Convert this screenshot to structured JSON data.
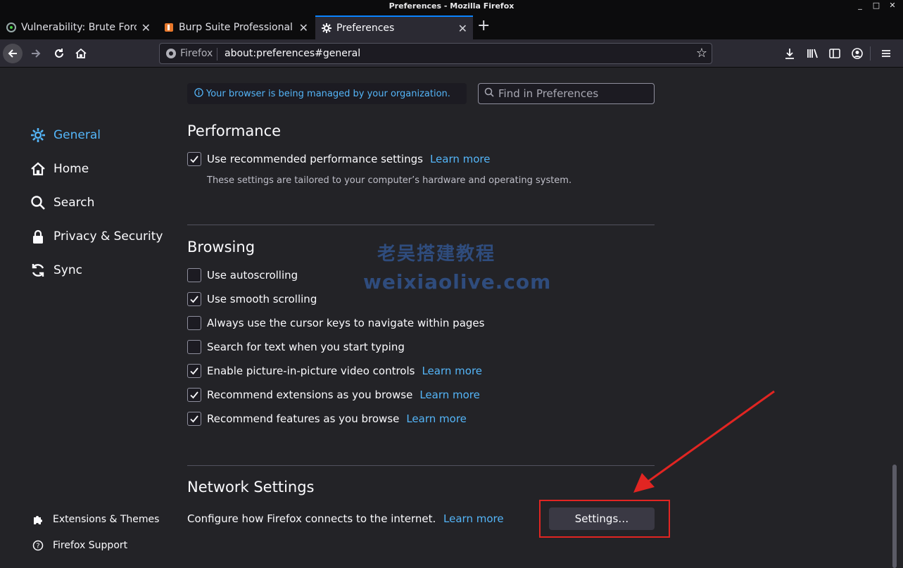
{
  "window": {
    "title": "Preferences - Mozilla Firefox",
    "controls": [
      "_",
      "□",
      "✕"
    ]
  },
  "tabs": [
    {
      "title": "Vulnerability: Brute Force",
      "favicon": "dvwa-icon",
      "active": false
    },
    {
      "title": "Burp Suite Professional",
      "favicon": "burp-icon",
      "active": false
    },
    {
      "title": "Preferences",
      "favicon": "gear-icon",
      "active": true
    }
  ],
  "newtab_label": "+",
  "urlbar": {
    "identity": "Firefox",
    "url": "about:preferences#general"
  },
  "sidebar": {
    "categories": [
      {
        "label": "General",
        "icon": "gear-icon",
        "selected": true
      },
      {
        "label": "Home",
        "icon": "home-icon",
        "selected": false
      },
      {
        "label": "Search",
        "icon": "search-icon",
        "selected": false
      },
      {
        "label": "Privacy & Security",
        "icon": "lock-icon",
        "selected": false
      },
      {
        "label": "Sync",
        "icon": "sync-icon",
        "selected": false
      }
    ],
    "footer": [
      {
        "label": "Extensions & Themes",
        "icon": "puzzle-icon"
      },
      {
        "label": "Firefox Support",
        "icon": "help-icon"
      }
    ]
  },
  "managed_notice": "Your browser is being managed by your organization.",
  "search_placeholder": "Find in Preferences",
  "performance": {
    "heading": "Performance",
    "option": {
      "label": "Use recommended performance settings",
      "checked": true,
      "learn_more": "Learn more"
    },
    "description": "These settings are tailored to your computer’s hardware and operating system."
  },
  "browsing": {
    "heading": "Browsing",
    "options": [
      {
        "label": "Use autoscrolling",
        "checked": false,
        "learn_more": ""
      },
      {
        "label": "Use smooth scrolling",
        "checked": true,
        "learn_more": ""
      },
      {
        "label": "Always use the cursor keys to navigate within pages",
        "checked": false,
        "learn_more": ""
      },
      {
        "label": "Search for text when you start typing",
        "checked": false,
        "learn_more": ""
      },
      {
        "label": "Enable picture-in-picture video controls",
        "checked": true,
        "learn_more": "Learn more"
      },
      {
        "label": "Recommend extensions as you browse",
        "checked": true,
        "learn_more": "Learn more"
      },
      {
        "label": "Recommend features as you browse",
        "checked": true,
        "learn_more": "Learn more"
      }
    ]
  },
  "network": {
    "heading": "Network Settings",
    "description": "Configure how Firefox connects to the internet.",
    "learn_more": "Learn more",
    "button": "Settings…"
  },
  "watermark": {
    "line1": "老吴搭建教程",
    "line2": "weixiaolive.com"
  },
  "colors": {
    "accent": "#54b5f8",
    "annotation": "#e12522"
  }
}
